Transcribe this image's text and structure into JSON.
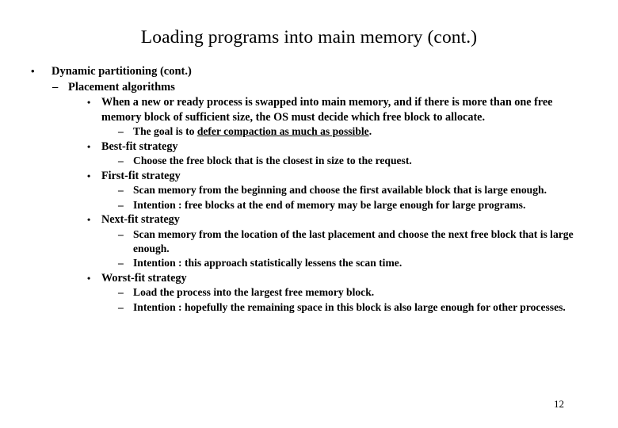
{
  "slide": {
    "title": "Loading programs into main memory (cont.)",
    "page_number": "12",
    "bullet_markers": {
      "level1": "•",
      "level2": "–",
      "level3": "•",
      "level4": "–"
    },
    "content": [
      {
        "level": 1,
        "text": "Dynamic partitioning (cont.)"
      },
      {
        "level": 2,
        "text": "Placement algorithms"
      },
      {
        "level": 3,
        "text": "When a new or ready process is swapped into main memory, and if there is more than one free memory block of sufficient size, the OS must decide which free block to allocate."
      },
      {
        "level": 4,
        "text_before": "The goal is to ",
        "text_underlined": "defer compaction as much as possible",
        "text_after": "."
      },
      {
        "level": 3,
        "text": "Best-fit strategy"
      },
      {
        "level": 4,
        "text": "Choose the free block that is the closest in size to the request."
      },
      {
        "level": 3,
        "text": "First-fit strategy"
      },
      {
        "level": 4,
        "text": "Scan memory from the beginning and choose the first available block that is large enough."
      },
      {
        "level": 4,
        "text": "Intention : free blocks at the end of memory may be large enough for large programs."
      },
      {
        "level": 3,
        "text": "Next-fit strategy"
      },
      {
        "level": 4,
        "text": "Scan memory from the location of the last placement and choose the next free block that is large enough."
      },
      {
        "level": 4,
        "text": "Intention : this approach statistically lessens the scan time."
      },
      {
        "level": 3,
        "text": "Worst-fit strategy"
      },
      {
        "level": 4,
        "text": "Load the process into the largest free memory  block."
      },
      {
        "level": 4,
        "text": "Intention : hopefully the remaining space in this block is also large enough for other processes."
      }
    ]
  }
}
